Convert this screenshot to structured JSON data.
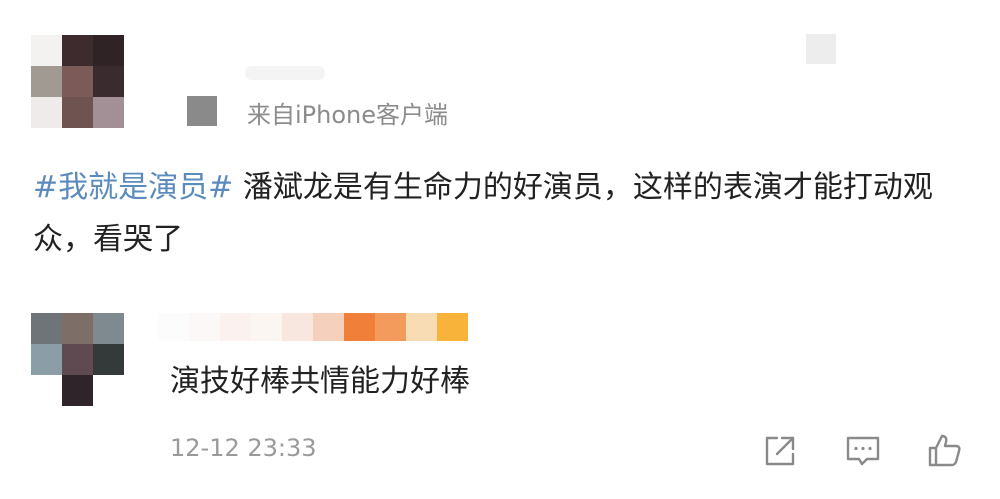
{
  "post": {
    "source": "来自iPhone客户端",
    "hashtag": "#我就是演员#",
    "text": " 潘斌龙是有生命力的好演员，这样的表演才能打动观众，看哭了"
  },
  "reply": {
    "text": "演技好棒共情能力好棒",
    "timestamp": "12-12 23:33"
  },
  "icons": {
    "share": "share-icon",
    "comment": "comment-icon",
    "like": "like-icon",
    "icon_color": "#8a8a8a"
  }
}
